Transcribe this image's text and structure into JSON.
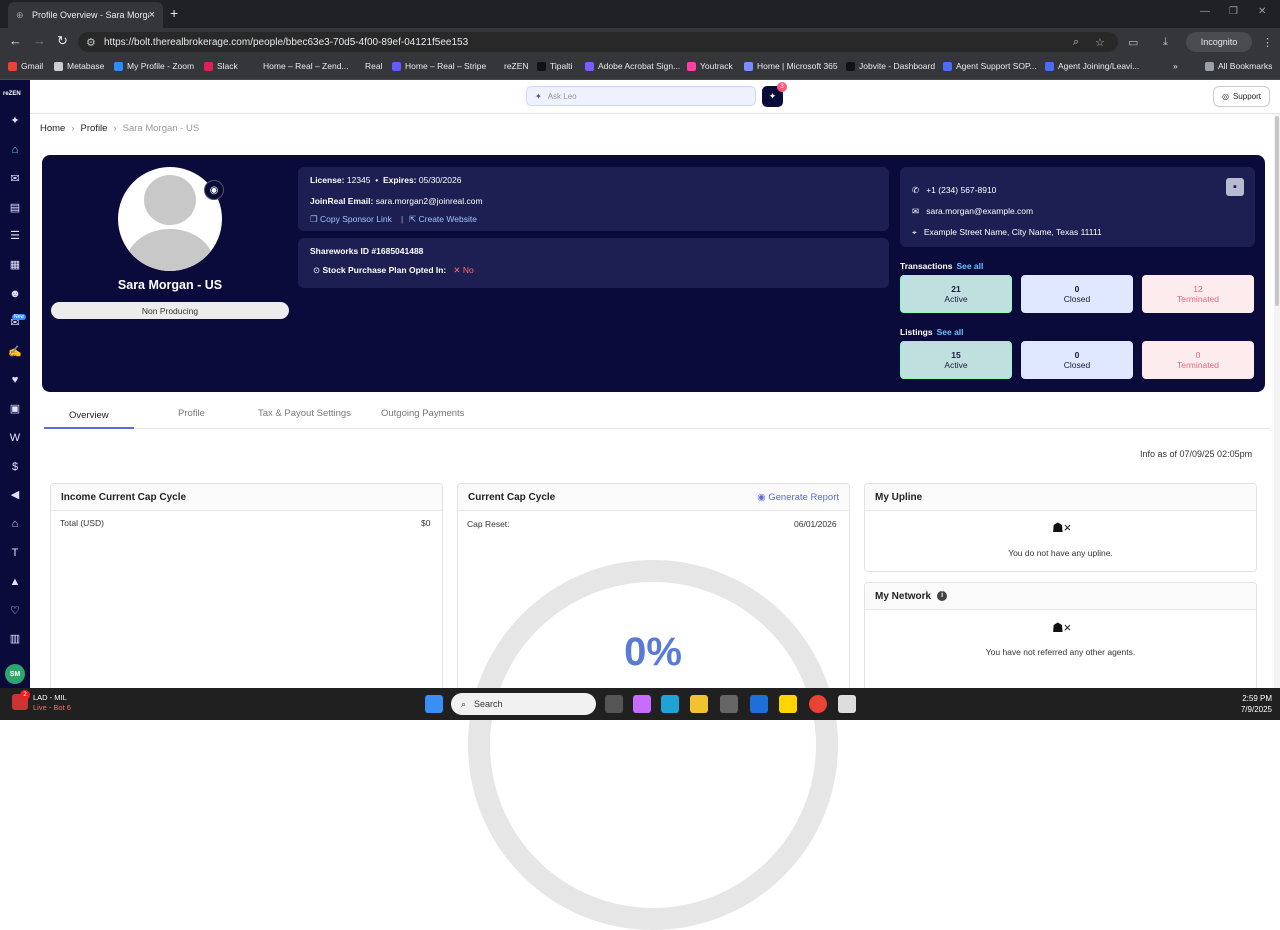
{
  "browser": {
    "tab_title": "Profile Overview - Sara Morgan",
    "url": "https://bolt.therealbrokerage.com/people/bbec63e3-70d5-4f00-89ef-04121f5ee153",
    "incognito": "Incognito",
    "bookmarks": [
      "Gmail",
      "Metabase",
      "My Profile - Zoom",
      "Slack",
      "Home – Real – Zend...",
      "Real",
      "Home – Real – Stripe",
      "reZEN",
      "Tipalti",
      "Adobe Acrobat Sign...",
      "Youtrack",
      "Home | Microsoft 365",
      "Jobvite - Dashboard",
      "Agent Support SOP...",
      "Agent Joining/Leavi..."
    ],
    "all_bookmarks": "All Bookmarks"
  },
  "app": {
    "logo": "reZEN",
    "new_badge": "New",
    "user_initials": "SM",
    "ask_placeholder": "Ask Leo",
    "leo_badge": "3",
    "support": "Support"
  },
  "breadcrumb": {
    "home": "Home",
    "profile": "Profile",
    "current": "Sara Morgan - US"
  },
  "profile": {
    "name": "Sara Morgan - US",
    "status": "Non Producing",
    "license_label": "License:",
    "license": "12345",
    "expires_label": "Expires:",
    "expires": "05/30/2026",
    "email_label": "JoinReal Email:",
    "email": "sara.morgan2@joinreal.com",
    "copy_sponsor": "Copy Sponsor Link",
    "create_website": "Create Website",
    "shareworks": "Shareworks ID #1685041488",
    "stock_label": "Stock Purchase Plan Opted In:",
    "stock_value": "No",
    "phone": "+1 (234) 567-8910",
    "contact_email": "sara.morgan@example.com",
    "address": "Example Street Name, City Name, Texas 11111"
  },
  "transactions": {
    "title": "Transactions",
    "see_all": "See all",
    "active_n": "21",
    "active": "Active",
    "closed_n": "0",
    "closed": "Closed",
    "term_n": "12",
    "term": "Terminated"
  },
  "listings": {
    "title": "Listings",
    "see_all": "See all",
    "active_n": "15",
    "active": "Active",
    "closed_n": "0",
    "closed": "Closed",
    "term_n": "0",
    "term": "Terminated"
  },
  "tabs": [
    "Overview",
    "Profile",
    "Tax & Payout Settings",
    "Outgoing Payments"
  ],
  "info_as_of": "Info as of 07/09/25 02:05pm",
  "income": {
    "title": "Income Current Cap Cycle",
    "total_label": "Total (USD)",
    "total": "$0"
  },
  "cap": {
    "title": "Current Cap Cycle",
    "generate": "Generate Report",
    "reset_label": "Cap Reset:",
    "reset": "06/01/2026",
    "percent": "0%"
  },
  "upline": {
    "title": "My Upline",
    "msg": "You do not have any upline."
  },
  "network": {
    "title": "My Network",
    "msg": "You have not referred any other agents."
  },
  "taskbar": {
    "weather_title": "LAD - MIL",
    "weather_sub": "Live - Bot 6",
    "weather_badge": "2",
    "search": "Search",
    "time": "2:59 PM",
    "date": "7/9/2025"
  }
}
